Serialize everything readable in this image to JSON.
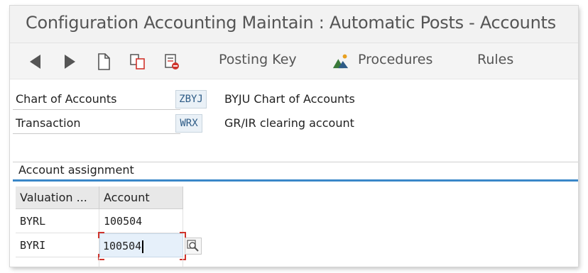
{
  "window": {
    "title": "Configuration Accounting Maintain : Automatic Posts - Accounts"
  },
  "toolbar": {
    "icons": [
      "back-arrow-icon",
      "forward-arrow-icon",
      "new-document-icon",
      "copy-document-icon",
      "delete-document-icon"
    ],
    "posting_key_label": "Posting Key",
    "procedures_label": "Procedures",
    "rules_label": "Rules"
  },
  "header_fields": {
    "chart_of_accounts": {
      "label": "Chart of Accounts",
      "value": "ZBYJ",
      "description": "BYJU Chart of Accounts"
    },
    "transaction": {
      "label": "Transaction",
      "value": "WRX",
      "description": "GR/IR clearing account"
    }
  },
  "account_assignment": {
    "title": "Account assignment",
    "columns": [
      "Valuation ...",
      "Account"
    ],
    "rows": [
      {
        "valuation": "BYRL",
        "account": "100504"
      },
      {
        "valuation": "BYRI",
        "account": "100504"
      }
    ]
  },
  "colors": {
    "accent_blue": "#3a87c8",
    "focus_red": "#d0342c",
    "value_field_bg": "#eaf1f7"
  }
}
